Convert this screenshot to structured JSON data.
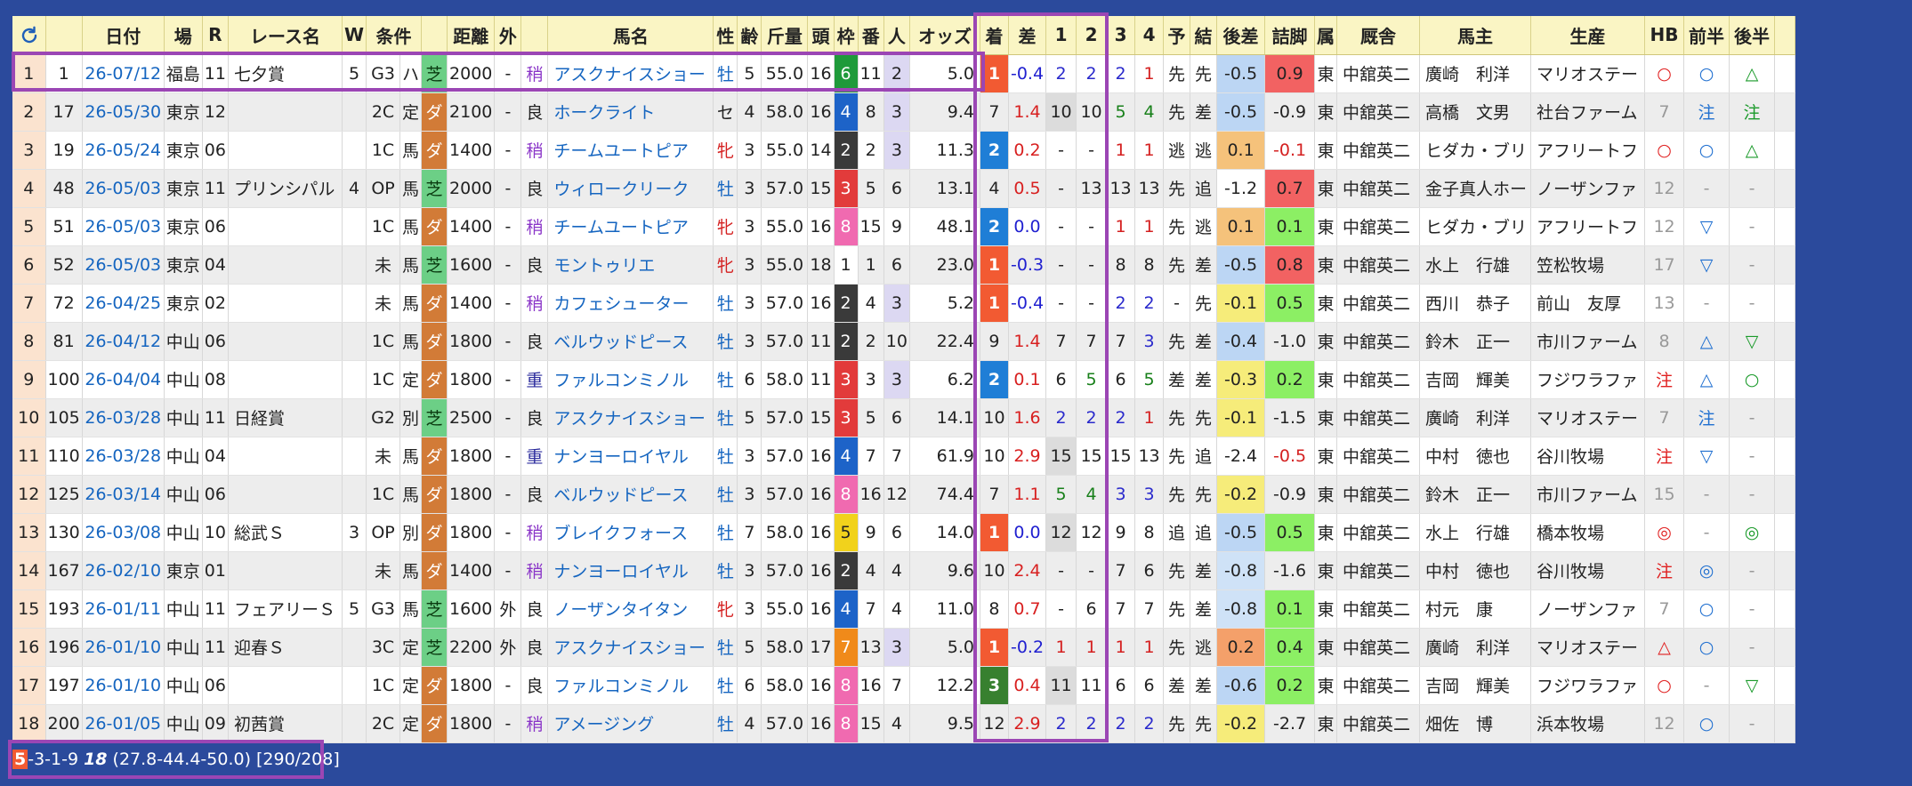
{
  "headers": [
    "",
    "",
    "日付",
    "場",
    "R",
    "レース名",
    "W",
    "条件",
    "",
    "距離",
    "外",
    "",
    "馬名",
    "性",
    "齢",
    "斤量",
    "頭",
    "枠",
    "番",
    "人",
    "オッズ",
    "着",
    "差",
    "1",
    "2",
    "3",
    "4",
    "予",
    "結",
    "後差",
    "詰脚",
    "属",
    "厩舎",
    "馬主",
    "生産",
    "HB",
    "前半",
    "後半",
    ""
  ],
  "rows": [
    {
      "no": "1",
      "id": "1",
      "date": "26-07/12",
      "venue": "福島",
      "r": "11",
      "race": "七夕賞",
      "w": "5",
      "grade": "G3",
      "cond": "ハ",
      "surf": "芝",
      "dist": "2000",
      "out": "-",
      "going": "稍",
      "horse": "アスクナイスショー",
      "sex": "牡",
      "age": "5",
      "wt": "55.0",
      "heads": "16",
      "waku": "6",
      "ban": "11",
      "pop": "2",
      "odds": "5.0",
      "rank": "1",
      "sa": "-0.4",
      "c1": "2",
      "c2": "2",
      "c3": "2",
      "c4": "1",
      "yo": "先",
      "ke": "先",
      "gosa": "-0.5",
      "tsume": "0.9",
      "zoku": "東",
      "trainer": "中舘英二",
      "owner": "廣崎　利洋",
      "breeder": "マリオステー",
      "hb": "○",
      "zen": "○",
      "kou": "△"
    },
    {
      "no": "2",
      "id": "17",
      "date": "26-05/30",
      "venue": "東京",
      "r": "12",
      "race": "",
      "w": "",
      "grade": "2C",
      "cond": "定",
      "surf": "ダ",
      "dist": "2100",
      "out": "-",
      "going": "良",
      "horse": "ホークライト",
      "sex": "セ",
      "age": "4",
      "wt": "58.0",
      "heads": "16",
      "waku": "4",
      "ban": "8",
      "pop": "3",
      "odds": "9.4",
      "rank": "7",
      "sa": "1.4",
      "c1": "10",
      "c2": "10",
      "c3": "5",
      "c4": "4",
      "yo": "先",
      "ke": "差",
      "gosa": "-0.5",
      "tsume": "-0.9",
      "zoku": "東",
      "trainer": "中舘英二",
      "owner": "高橋　文男",
      "breeder": "社台ファーム",
      "hb": "7",
      "zen": "注",
      "kou": "注"
    },
    {
      "no": "3",
      "id": "19",
      "date": "26-05/24",
      "venue": "東京",
      "r": "06",
      "race": "",
      "w": "",
      "grade": "1C",
      "cond": "馬",
      "surf": "ダ",
      "dist": "1400",
      "out": "-",
      "going": "稍",
      "horse": "チームユートピア",
      "sex": "牝",
      "age": "3",
      "wt": "55.0",
      "heads": "14",
      "waku": "2",
      "ban": "2",
      "pop": "3",
      "odds": "11.3",
      "rank": "2",
      "sa": "0.2",
      "c1": "-",
      "c2": "-",
      "c3": "1",
      "c4": "1",
      "yo": "逃",
      "ke": "逃",
      "gosa": "0.1",
      "tsume": "-0.1",
      "zoku": "東",
      "trainer": "中舘英二",
      "owner": "ヒダカ・ブリ",
      "breeder": "アフリートフ",
      "hb": "○",
      "zen": "○",
      "kou": "△"
    },
    {
      "no": "4",
      "id": "48",
      "date": "26-05/03",
      "venue": "東京",
      "r": "11",
      "race": "プリンシパル",
      "w": "4",
      "grade": "OP",
      "cond": "馬",
      "surf": "芝",
      "dist": "2000",
      "out": "-",
      "going": "良",
      "horse": "ウィロークリーク",
      "sex": "牡",
      "age": "3",
      "wt": "57.0",
      "heads": "15",
      "waku": "3",
      "ban": "5",
      "pop": "6",
      "odds": "13.1",
      "rank": "4",
      "sa": "0.5",
      "c1": "-",
      "c2": "13",
      "c3": "13",
      "c4": "13",
      "yo": "先",
      "ke": "追",
      "gosa": "-1.2",
      "tsume": "0.7",
      "zoku": "東",
      "trainer": "中舘英二",
      "owner": "金子真人ホー",
      "breeder": "ノーザンファ",
      "hb": "12",
      "zen": "-",
      "kou": "-"
    },
    {
      "no": "5",
      "id": "51",
      "date": "26-05/03",
      "venue": "東京",
      "r": "06",
      "race": "",
      "w": "",
      "grade": "1C",
      "cond": "馬",
      "surf": "ダ",
      "dist": "1400",
      "out": "-",
      "going": "稍",
      "horse": "チームユートピア",
      "sex": "牝",
      "age": "3",
      "wt": "55.0",
      "heads": "16",
      "waku": "8",
      "ban": "15",
      "pop": "9",
      "odds": "48.1",
      "rank": "2",
      "sa": "0.0",
      "c1": "-",
      "c2": "-",
      "c3": "1",
      "c4": "1",
      "yo": "先",
      "ke": "逃",
      "gosa": "0.1",
      "tsume": "0.1",
      "zoku": "東",
      "trainer": "中舘英二",
      "owner": "ヒダカ・ブリ",
      "breeder": "アフリートフ",
      "hb": "12",
      "zen": "▽",
      "kou": "-"
    },
    {
      "no": "6",
      "id": "52",
      "date": "26-05/03",
      "venue": "東京",
      "r": "04",
      "race": "",
      "w": "",
      "grade": "未",
      "cond": "馬",
      "surf": "芝",
      "dist": "1600",
      "out": "-",
      "going": "良",
      "horse": "モントゥリエ",
      "sex": "牝",
      "age": "3",
      "wt": "55.0",
      "heads": "18",
      "waku": "1",
      "ban": "1",
      "pop": "6",
      "odds": "23.0",
      "rank": "1",
      "sa": "-0.3",
      "c1": "-",
      "c2": "-",
      "c3": "8",
      "c4": "8",
      "yo": "先",
      "ke": "差",
      "gosa": "-0.5",
      "tsume": "0.8",
      "zoku": "東",
      "trainer": "中舘英二",
      "owner": "水上　行雄",
      "breeder": "笠松牧場",
      "hb": "17",
      "zen": "▽",
      "kou": "-"
    },
    {
      "no": "7",
      "id": "72",
      "date": "26-04/25",
      "venue": "東京",
      "r": "02",
      "race": "",
      "w": "",
      "grade": "未",
      "cond": "馬",
      "surf": "ダ",
      "dist": "1400",
      "out": "-",
      "going": "稍",
      "horse": "カフェシューター",
      "sex": "牡",
      "age": "3",
      "wt": "57.0",
      "heads": "16",
      "waku": "2",
      "ban": "4",
      "pop": "3",
      "odds": "5.2",
      "rank": "1",
      "sa": "-0.4",
      "c1": "-",
      "c2": "-",
      "c3": "2",
      "c4": "2",
      "yo": "-",
      "ke": "先",
      "gosa": "-0.1",
      "tsume": "0.5",
      "zoku": "東",
      "trainer": "中舘英二",
      "owner": "西川　恭子",
      "breeder": "前山　友厚",
      "hb": "13",
      "zen": "-",
      "kou": "-"
    },
    {
      "no": "8",
      "id": "81",
      "date": "26-04/12",
      "venue": "中山",
      "r": "06",
      "race": "",
      "w": "",
      "grade": "1C",
      "cond": "馬",
      "surf": "ダ",
      "dist": "1800",
      "out": "-",
      "going": "良",
      "horse": "ベルウッドピース",
      "sex": "牡",
      "age": "3",
      "wt": "57.0",
      "heads": "11",
      "waku": "2",
      "ban": "2",
      "pop": "10",
      "odds": "22.4",
      "rank": "9",
      "sa": "1.4",
      "c1": "7",
      "c2": "7",
      "c3": "7",
      "c4": "3",
      "yo": "先",
      "ke": "差",
      "gosa": "-0.4",
      "tsume": "-1.0",
      "zoku": "東",
      "trainer": "中舘英二",
      "owner": "鈴木　正一",
      "breeder": "市川ファーム",
      "hb": "8",
      "zen": "△",
      "kou": "▽"
    },
    {
      "no": "9",
      "id": "100",
      "date": "26-04/04",
      "venue": "中山",
      "r": "08",
      "race": "",
      "w": "",
      "grade": "1C",
      "cond": "定",
      "surf": "ダ",
      "dist": "1800",
      "out": "-",
      "going": "重",
      "horse": "ファルコンミノル",
      "sex": "牡",
      "age": "6",
      "wt": "58.0",
      "heads": "11",
      "waku": "3",
      "ban": "3",
      "pop": "3",
      "odds": "6.2",
      "rank": "2",
      "sa": "0.1",
      "c1": "6",
      "c2": "5",
      "c3": "6",
      "c4": "5",
      "yo": "差",
      "ke": "差",
      "gosa": "-0.3",
      "tsume": "0.2",
      "zoku": "東",
      "trainer": "中舘英二",
      "owner": "吉岡　輝美",
      "breeder": "フジワラファ",
      "hb": "注",
      "zen": "△",
      "kou": "○"
    },
    {
      "no": "10",
      "id": "105",
      "date": "26-03/28",
      "venue": "中山",
      "r": "11",
      "race": "日経賞",
      "w": "",
      "grade": "G2",
      "cond": "別",
      "surf": "芝",
      "dist": "2500",
      "out": "-",
      "going": "良",
      "horse": "アスクナイスショー",
      "sex": "牡",
      "age": "5",
      "wt": "57.0",
      "heads": "15",
      "waku": "3",
      "ban": "5",
      "pop": "6",
      "odds": "14.1",
      "rank": "10",
      "sa": "1.6",
      "c1": "2",
      "c2": "2",
      "c3": "2",
      "c4": "1",
      "yo": "先",
      "ke": "先",
      "gosa": "-0.1",
      "tsume": "-1.5",
      "zoku": "東",
      "trainer": "中舘英二",
      "owner": "廣崎　利洋",
      "breeder": "マリオステー",
      "hb": "7",
      "zen": "注",
      "kou": "-"
    },
    {
      "no": "11",
      "id": "110",
      "date": "26-03/28",
      "venue": "中山",
      "r": "04",
      "race": "",
      "w": "",
      "grade": "未",
      "cond": "馬",
      "surf": "ダ",
      "dist": "1800",
      "out": "-",
      "going": "重",
      "horse": "ナンヨーロイヤル",
      "sex": "牡",
      "age": "3",
      "wt": "57.0",
      "heads": "16",
      "waku": "4",
      "ban": "7",
      "pop": "7",
      "odds": "61.9",
      "rank": "10",
      "sa": "2.9",
      "c1": "15",
      "c2": "15",
      "c3": "15",
      "c4": "13",
      "yo": "先",
      "ke": "追",
      "gosa": "-2.4",
      "tsume": "-0.5",
      "zoku": "東",
      "trainer": "中舘英二",
      "owner": "中村　徳也",
      "breeder": "谷川牧場",
      "hb": "注",
      "zen": "▽",
      "kou": "-"
    },
    {
      "no": "12",
      "id": "125",
      "date": "26-03/14",
      "venue": "中山",
      "r": "06",
      "race": "",
      "w": "",
      "grade": "1C",
      "cond": "馬",
      "surf": "ダ",
      "dist": "1800",
      "out": "-",
      "going": "良",
      "horse": "ベルウッドピース",
      "sex": "牡",
      "age": "3",
      "wt": "57.0",
      "heads": "16",
      "waku": "8",
      "ban": "16",
      "pop": "12",
      "odds": "74.4",
      "rank": "7",
      "sa": "1.1",
      "c1": "5",
      "c2": "4",
      "c3": "3",
      "c4": "3",
      "yo": "先",
      "ke": "先",
      "gosa": "-0.2",
      "tsume": "-0.9",
      "zoku": "東",
      "trainer": "中舘英二",
      "owner": "鈴木　正一",
      "breeder": "市川ファーム",
      "hb": "15",
      "zen": "-",
      "kou": "-"
    },
    {
      "no": "13",
      "id": "130",
      "date": "26-03/08",
      "venue": "中山",
      "r": "10",
      "race": "総武Ｓ",
      "w": "3",
      "grade": "OP",
      "cond": "別",
      "surf": "ダ",
      "dist": "1800",
      "out": "-",
      "going": "稍",
      "horse": "ブレイクフォース",
      "sex": "牡",
      "age": "7",
      "wt": "58.0",
      "heads": "16",
      "waku": "5",
      "ban": "9",
      "pop": "6",
      "odds": "14.0",
      "rank": "1",
      "sa": "0.0",
      "c1": "12",
      "c2": "12",
      "c3": "9",
      "c4": "8",
      "yo": "追",
      "ke": "追",
      "gosa": "-0.5",
      "tsume": "0.5",
      "zoku": "東",
      "trainer": "中舘英二",
      "owner": "水上　行雄",
      "breeder": "橋本牧場",
      "hb": "◎",
      "zen": "-",
      "kou": "◎"
    },
    {
      "no": "14",
      "id": "167",
      "date": "26-02/10",
      "venue": "東京",
      "r": "01",
      "race": "",
      "w": "",
      "grade": "未",
      "cond": "馬",
      "surf": "ダ",
      "dist": "1400",
      "out": "-",
      "going": "稍",
      "horse": "ナンヨーロイヤル",
      "sex": "牡",
      "age": "3",
      "wt": "57.0",
      "heads": "16",
      "waku": "2",
      "ban": "4",
      "pop": "4",
      "odds": "9.6",
      "rank": "10",
      "sa": "2.4",
      "c1": "-",
      "c2": "-",
      "c3": "7",
      "c4": "6",
      "yo": "先",
      "ke": "差",
      "gosa": "-0.8",
      "tsume": "-1.6",
      "zoku": "東",
      "trainer": "中舘英二",
      "owner": "中村　徳也",
      "breeder": "谷川牧場",
      "hb": "注",
      "zen": "◎",
      "kou": "-"
    },
    {
      "no": "15",
      "id": "193",
      "date": "26-01/11",
      "venue": "中山",
      "r": "11",
      "race": "フェアリーＳ",
      "w": "5",
      "grade": "G3",
      "cond": "馬",
      "surf": "芝",
      "dist": "1600",
      "out": "外",
      "going": "良",
      "horse": "ノーザンタイタン",
      "sex": "牝",
      "age": "3",
      "wt": "55.0",
      "heads": "16",
      "waku": "4",
      "ban": "7",
      "pop": "4",
      "odds": "11.0",
      "rank": "8",
      "sa": "0.7",
      "c1": "-",
      "c2": "6",
      "c3": "7",
      "c4": "7",
      "yo": "先",
      "ke": "差",
      "gosa": "-0.8",
      "tsume": "0.1",
      "zoku": "東",
      "trainer": "中舘英二",
      "owner": "村元　康",
      "breeder": "ノーザンファ",
      "hb": "7",
      "zen": "○",
      "kou": "-"
    },
    {
      "no": "16",
      "id": "196",
      "date": "26-01/10",
      "venue": "中山",
      "r": "11",
      "race": "迎春Ｓ",
      "w": "",
      "grade": "3C",
      "cond": "定",
      "surf": "芝",
      "dist": "2200",
      "out": "外",
      "going": "良",
      "horse": "アスクナイスショー",
      "sex": "牡",
      "age": "5",
      "wt": "58.0",
      "heads": "17",
      "waku": "7",
      "ban": "13",
      "pop": "3",
      "odds": "5.0",
      "rank": "1",
      "sa": "-0.2",
      "c1": "1",
      "c2": "1",
      "c3": "1",
      "c4": "1",
      "yo": "先",
      "ke": "逃",
      "gosa": "0.2",
      "tsume": "0.4",
      "zoku": "東",
      "trainer": "中舘英二",
      "owner": "廣崎　利洋",
      "breeder": "マリオステー",
      "hb": "△",
      "zen": "○",
      "kou": "-"
    },
    {
      "no": "17",
      "id": "197",
      "date": "26-01/10",
      "venue": "中山",
      "r": "06",
      "race": "",
      "w": "",
      "grade": "1C",
      "cond": "定",
      "surf": "ダ",
      "dist": "1800",
      "out": "-",
      "going": "良",
      "horse": "ファルコンミノル",
      "sex": "牡",
      "age": "6",
      "wt": "58.0",
      "heads": "16",
      "waku": "8",
      "ban": "16",
      "pop": "7",
      "odds": "12.2",
      "rank": "3",
      "sa": "0.4",
      "c1": "11",
      "c2": "11",
      "c3": "6",
      "c4": "6",
      "yo": "差",
      "ke": "差",
      "gosa": "-0.6",
      "tsume": "0.2",
      "zoku": "東",
      "trainer": "中舘英二",
      "owner": "吉岡　輝美",
      "breeder": "フジワラファ",
      "hb": "○",
      "zen": "-",
      "kou": "▽"
    },
    {
      "no": "18",
      "id": "200",
      "date": "26-01/05",
      "venue": "中山",
      "r": "09",
      "race": "初茜賞",
      "w": "",
      "grade": "2C",
      "cond": "定",
      "surf": "ダ",
      "dist": "1800",
      "out": "-",
      "going": "稍",
      "horse": "アメージング",
      "sex": "牡",
      "age": "4",
      "wt": "57.0",
      "heads": "16",
      "waku": "8",
      "ban": "15",
      "pop": "4",
      "odds": "9.5",
      "rank": "12",
      "sa": "2.9",
      "c1": "2",
      "c2": "2",
      "c3": "2",
      "c4": "2",
      "yo": "先",
      "ke": "先",
      "gosa": "-0.2",
      "tsume": "-2.7",
      "zoku": "東",
      "trainer": "中舘英二",
      "owner": "畑佐　博",
      "breeder": "浜本牧場",
      "hb": "12",
      "zen": "○",
      "kou": "-"
    }
  ],
  "footer": {
    "first": "5",
    "record": "-3-1-9",
    "total": "18",
    "rates": "(27.8-44.4-50.0)",
    "count": "[290/208]"
  },
  "colors": {
    "background": "#2b4a9c",
    "header_bg": "#faf5c4",
    "highlight_box": "#9b46b4",
    "rank1": "#f25a32",
    "rank2": "#1f7ed6",
    "rank3": "#37802f"
  }
}
